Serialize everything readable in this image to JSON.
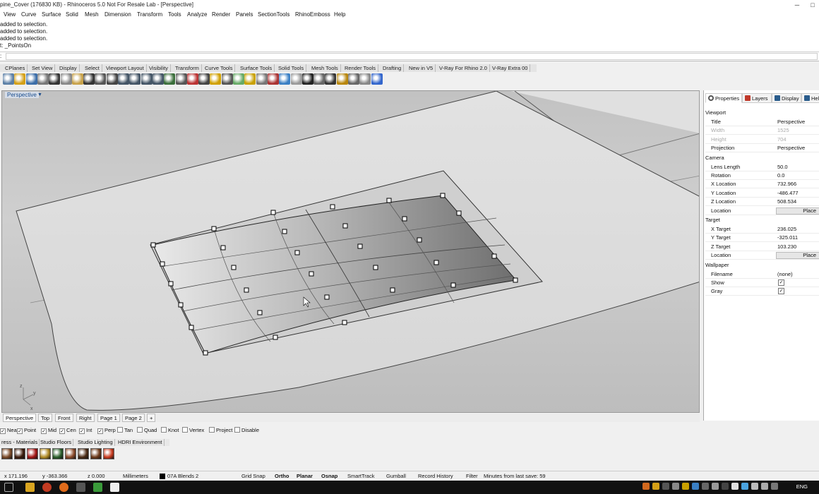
{
  "window": {
    "title": "pine_Cover (176830 KB) - Rhinoceros 5.0 Not For Resale Lab - [Perspective]",
    "min_glyph": "─",
    "max_glyph": "□"
  },
  "menu": [
    "View",
    "Curve",
    "Surface",
    "Solid",
    "Mesh",
    "Dimension",
    "Transform",
    "Tools",
    "Analyze",
    "Render",
    "Panels",
    "SectionTools",
    "RhinoEmboss",
    "Help"
  ],
  "command_history": [
    "added to selection.",
    "added to selection.",
    "added to selection.",
    "t: _PointsOn"
  ],
  "command_prompt": "",
  "toolbar_tabs": [
    "CPlanes",
    "Set View",
    "Display",
    "Select",
    "Viewport Layout",
    "Visibility",
    "Transform",
    "Curve Tools",
    "Surface Tools",
    "Solid Tools",
    "Mesh Tools",
    "Render Tools",
    "Drafting",
    "New in V5",
    "V-Ray For Rhino 2.0",
    "V-Ray Extra 00"
  ],
  "toolbar_icons": [
    "new-icon",
    "open-icon",
    "save-icon",
    "print-icon",
    "cut-icon",
    "copy-icon",
    "paste-icon",
    "undo-icon",
    "pan-icon",
    "move-icon",
    "zoom-icon",
    "zoom-window-icon",
    "zoom-extents-icon",
    "zoom-selected-icon",
    "rotate-view-icon",
    "viewport-layout-icon",
    "car-icon",
    "curve-icon",
    "circle-icon",
    "point-icon",
    "layer-icon",
    "light-icon",
    "lock-icon",
    "material-icon",
    "color-icon",
    "render-icon",
    "sphere-icon",
    "shaded-icon",
    "rendered-icon",
    "options-icon",
    "grid-icon",
    "snap-icon",
    "help-icon"
  ],
  "viewport": {
    "label": "Perspective",
    "axis_z": "z",
    "axis_y": "y",
    "axis_x": "x"
  },
  "view_tabs": [
    "Perspective",
    "Top",
    "Front",
    "Right",
    "Page 1",
    "Page 2",
    "+"
  ],
  "osnaps": [
    {
      "label": "Near",
      "checked": true
    },
    {
      "label": "Point",
      "checked": true
    },
    {
      "label": "Mid",
      "checked": true
    },
    {
      "label": "Cen",
      "checked": true
    },
    {
      "label": "Int",
      "checked": true
    },
    {
      "label": "Perp",
      "checked": true
    },
    {
      "label": "Tan",
      "checked": false
    },
    {
      "label": "Quad",
      "checked": false
    },
    {
      "label": "Knot",
      "checked": false
    },
    {
      "label": "Vertex",
      "checked": false
    },
    {
      "label": "Project",
      "checked": false
    },
    {
      "label": "Disable",
      "checked": false
    }
  ],
  "material_tabs": [
    "ress - Materials",
    "Studio Floors",
    "Studio Lighting",
    "HDRI Environment"
  ],
  "material_swatches": [
    "#7a4a28",
    "#3d1c0c",
    "#a31515",
    "#b08a25",
    "#2b5e2b",
    "#8b4a2a",
    "#4a2a14",
    "#6d3a1b",
    "#c83a1e"
  ],
  "status": {
    "x": "x 171.196",
    "y": "y -363.366",
    "z": "z 0.000",
    "units": "Millimeters",
    "layer": "07A Blends 2",
    "toggles": [
      "Grid Snap",
      "Ortho",
      "Planar",
      "Osnap",
      "SmartTrack",
      "Gumball",
      "Record History",
      "Filter"
    ],
    "save_msg": "Minutes from last save: 59"
  },
  "panel": {
    "tabs": [
      "Properties",
      "Layers",
      "Display",
      "Help"
    ],
    "groups": {
      "viewport": "Viewport",
      "camera": "Camera",
      "target": "Target",
      "wallpaper": "Wallpaper"
    },
    "viewport_rows": [
      {
        "k": "Title",
        "v": "Perspective"
      },
      {
        "k": "Width",
        "v": "1525"
      },
      {
        "k": "Height",
        "v": "704"
      },
      {
        "k": "Projection",
        "v": "Perspective"
      }
    ],
    "camera_rows": [
      {
        "k": "Lens Length",
        "v": "50.0"
      },
      {
        "k": "Rotation",
        "v": "0.0"
      },
      {
        "k": "X Location",
        "v": "732.966"
      },
      {
        "k": "Y Location",
        "v": "-486.477"
      },
      {
        "k": "Z Location",
        "v": "508.534"
      },
      {
        "k": "Location",
        "v": "Place"
      }
    ],
    "target_rows": [
      {
        "k": "X Target",
        "v": "236.025"
      },
      {
        "k": "Y Target",
        "v": "-325.011"
      },
      {
        "k": "Z Target",
        "v": "103.230"
      },
      {
        "k": "Location",
        "v": "Place"
      }
    ],
    "wallpaper_rows": [
      {
        "k": "Filename",
        "v": "(none)"
      },
      {
        "k": "Show",
        "v": "✓"
      },
      {
        "k": "Gray",
        "v": "✓"
      }
    ]
  },
  "tray": {
    "lang": "ENG"
  }
}
